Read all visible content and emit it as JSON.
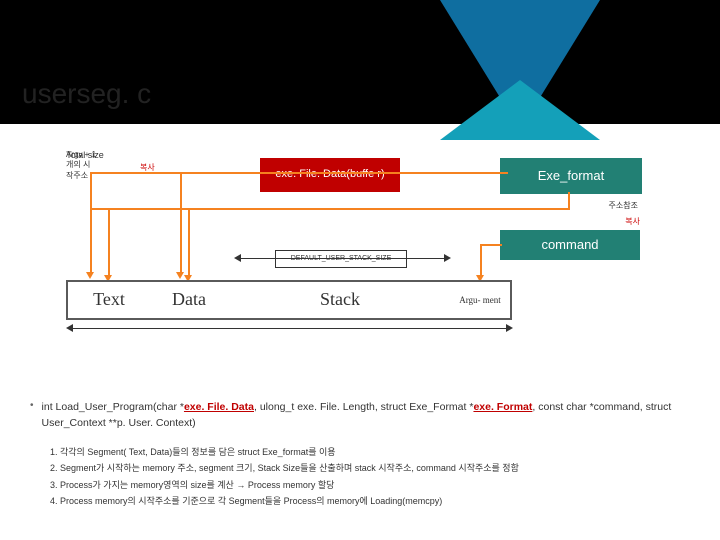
{
  "header": {
    "title": "userseg. c"
  },
  "diagram": {
    "exe_box": "exe. File. Data(buffe r)",
    "fmt_box": "Exe_format",
    "cmd_box": "command",
    "copy_label": "복사",
    "addr_ref_label": "주소참조",
    "copy2_label": "복사",
    "stack_size_label": "DEFAULT_USER_STACK_SIZE",
    "argv_hint": "Argv + 1 개의 시작주소",
    "segments": {
      "text": "Text",
      "data": "Data",
      "stack": "Stack",
      "arg": "Argu-\nment"
    },
    "total_size": "Total size"
  },
  "code": {
    "signature_prefix": "int Load_User_Program(char *",
    "arg1": "exe. File. Data",
    "mid1": ", ulong_t exe. File. Length, struct Exe_Format *",
    "arg2": "exe. Format",
    "mid2": ", const char *command, struct User_Context **p. User. Context)",
    "items": [
      "각각의 Segment( Text, Data)들의 정보를 담은 struct Exe_format를 이용",
      "Segment가 시작하는 memory 주소, segment 크기, Stack Size들을 산출하며 stack 시작주소, command 시작주소를 정함",
      "Process가 가지는 memory영역의 size를 계산 → Process memory 할당",
      "Process memory의 시작주소를 기준으로 각 Segment들을 Process의 memory에 Loading(memcpy)"
    ]
  }
}
